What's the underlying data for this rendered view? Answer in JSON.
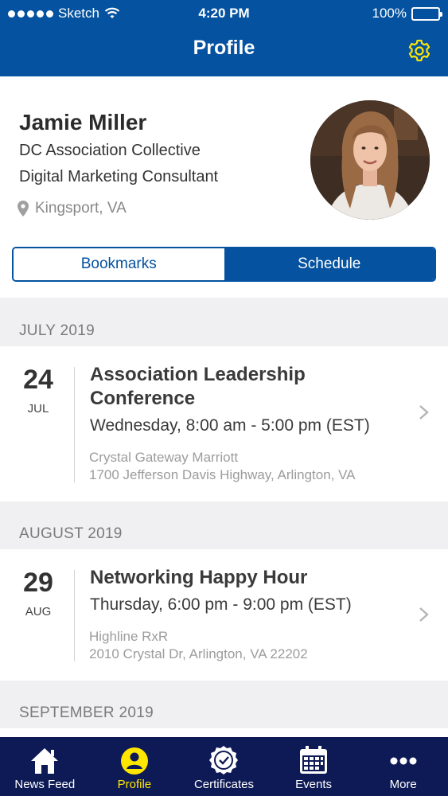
{
  "status_bar": {
    "carrier": "Sketch",
    "time": "4:20 PM",
    "battery": "100%"
  },
  "header": {
    "title": "Profile"
  },
  "profile": {
    "name": "Jamie Miller",
    "organization": "DC Association Collective",
    "role": "Digital Marketing Consultant",
    "location": "Kingsport, VA"
  },
  "segments": {
    "bookmarks": "Bookmarks",
    "schedule": "Schedule",
    "selected": "Schedule"
  },
  "sections": [
    {
      "month": "JULY 2019",
      "events": [
        {
          "day": "24",
          "mon": "JUL",
          "name": "Association Leadership Conference",
          "time": "Wednesday, 8:00 am - 5:00 pm (EST)",
          "venue": "Crystal Gateway Marriott",
          "address": "1700 Jefferson Davis Highway, Arlington, VA"
        }
      ]
    },
    {
      "month": "AUGUST 2019",
      "events": [
        {
          "day": "29",
          "mon": "AUG",
          "name": "Networking Happy Hour",
          "time": "Thursday, 6:00 pm - 9:00 pm (EST)",
          "venue": "Highline RxR",
          "address": "2010 Crystal Dr, Arlington, VA 22202"
        }
      ]
    },
    {
      "month": "SEPTEMBER 2019",
      "events": []
    }
  ],
  "tabs": [
    {
      "label": "News Feed",
      "icon": "home-icon"
    },
    {
      "label": "Profile",
      "icon": "person-icon",
      "active": true
    },
    {
      "label": "Certificates",
      "icon": "badge-icon"
    },
    {
      "label": "Events",
      "icon": "calendar-icon"
    },
    {
      "label": "More",
      "icon": "more-icon"
    }
  ],
  "colors": {
    "brand_blue": "#0452a0",
    "tab_bar": "#0d1a55",
    "accent_yellow": "#ffe600"
  }
}
